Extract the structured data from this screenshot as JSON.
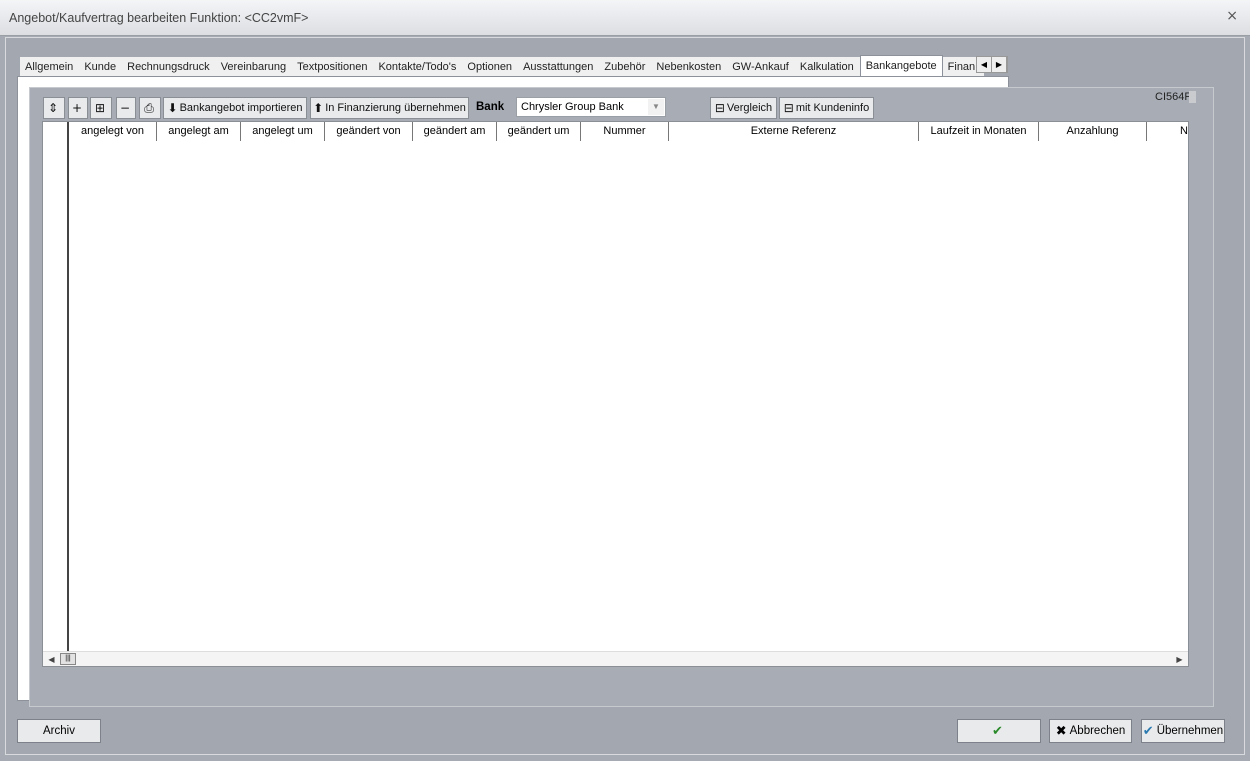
{
  "window": {
    "title": "Angebot/Kaufvertrag bearbeiten   Funktion: <CC2vmF>",
    "close_glyph": "×"
  },
  "tabs": [
    {
      "label": "Allgemein"
    },
    {
      "label": "Kunde"
    },
    {
      "label": "Rechnungsdruck"
    },
    {
      "label": "Vereinbarung"
    },
    {
      "label": "Textpositionen"
    },
    {
      "label": "Kontakte/Todo's"
    },
    {
      "label": "Optionen"
    },
    {
      "label": "Ausstattungen"
    },
    {
      "label": "Zubehör"
    },
    {
      "label": "Nebenkosten"
    },
    {
      "label": "GW-Ankauf"
    },
    {
      "label": "Kalkulation"
    },
    {
      "label": "Bankangebote"
    },
    {
      "label": "Finan:"
    }
  ],
  "active_tab": "Bankangebote",
  "panel_code": "CI564F",
  "toolbar": {
    "import_label": "Bankangebot importieren",
    "transfer_label": "In Finanzierung übernehmen",
    "bank_label": "Bank",
    "bank_value": "Chrysler Group Bank",
    "compare_label": "Vergleich",
    "customer_info_label": "mit Kundeninfo"
  },
  "grid": {
    "columns": [
      "angelegt von",
      "angelegt am",
      "angelegt um",
      "geändert von",
      "geändert am",
      "geändert um",
      "Nummer",
      "Externe Referenz",
      "Laufzeit in Monaten",
      "Anzahlung",
      "N"
    ],
    "rows": []
  },
  "footer": {
    "archive_label": "Archiv",
    "ok_label": "",
    "cancel_label": "Abbrechen",
    "apply_label": "Übernehmen"
  },
  "icons": {
    "ok": "ok-check-icon",
    "cancel": "x-icon",
    "apply": "check-icon"
  }
}
